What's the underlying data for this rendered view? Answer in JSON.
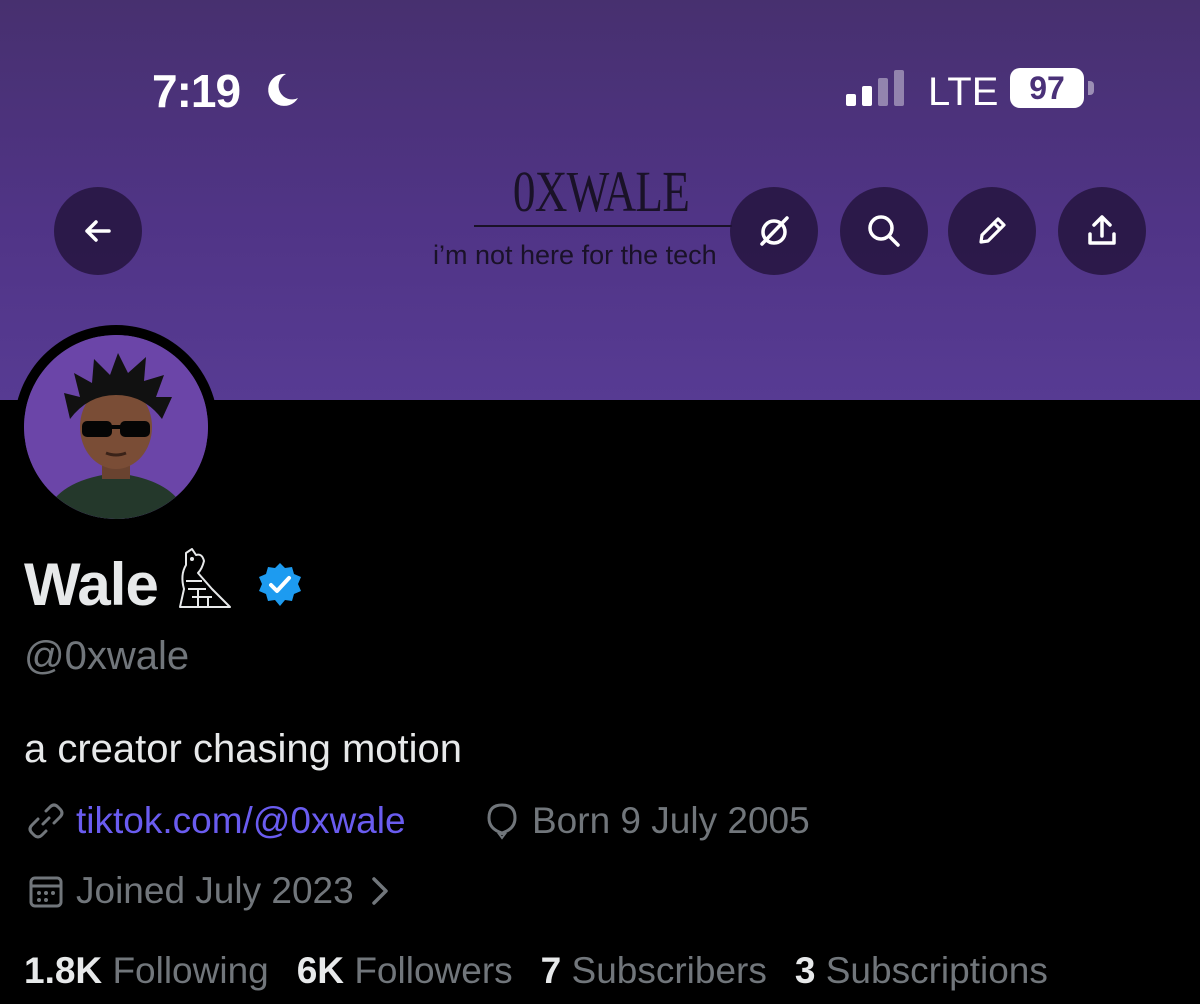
{
  "status_bar": {
    "time": "7:19",
    "network": "LTE",
    "battery": "97"
  },
  "banner": {
    "title": "0XWALE",
    "subtitle": "i’m not here for the tech",
    "color": "#503486"
  },
  "actions": {
    "back_icon": "back-arrow-icon",
    "grok_icon": "grok-icon",
    "search_icon": "search-icon",
    "edit_icon": "pencil-icon",
    "share_icon": "share-icon"
  },
  "profile": {
    "display_name": "Wale",
    "handle": "@0xwale",
    "bio": "a creator chasing motion",
    "link": "tiktok.com/@0xwale",
    "birthday": "Born 9 July 2005",
    "joined": "Joined July 2023",
    "verified_color": "#1d9bf0",
    "link_color": "#6a5cf0"
  },
  "stats": [
    {
      "value": "1.8K",
      "label": "Following"
    },
    {
      "value": "6K",
      "label": "Followers"
    },
    {
      "value": "7",
      "label": "Subscribers"
    },
    {
      "value": "3",
      "label": "Subscriptions"
    }
  ]
}
